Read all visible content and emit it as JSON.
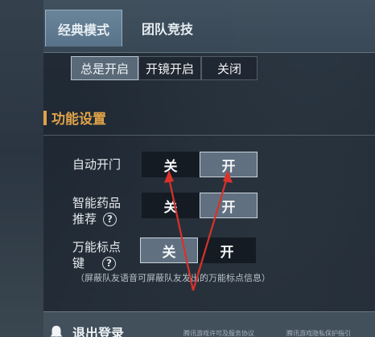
{
  "tabs": [
    {
      "label": "经典模式"
    },
    {
      "label": "团队竞技"
    }
  ],
  "top_row_label": "",
  "scope_options": [
    "总是开启",
    "开镜开启",
    "关闭"
  ],
  "section": {
    "title": "功能设置"
  },
  "settings": [
    {
      "label": "自动开门",
      "off": "关",
      "on": "开",
      "value": "开"
    },
    {
      "label_line1": "智能药品",
      "label_line2": "推荐",
      "off": "关",
      "on": "开",
      "value": "开"
    },
    {
      "label_line1": "万能标点",
      "label_line2": "键",
      "off": "关",
      "on": "开",
      "value": "关"
    }
  ],
  "note": "（屏蔽队友语音可屏蔽队友发出的万能标点信息）",
  "footer": {
    "logout": "退出登录",
    "link1": "腾讯游戏许可及服务协议",
    "link2": "腾讯游戏隐私保护指引"
  },
  "colors": {
    "accent": "#e0a24a",
    "annotation_arrow": "#d8322a"
  }
}
